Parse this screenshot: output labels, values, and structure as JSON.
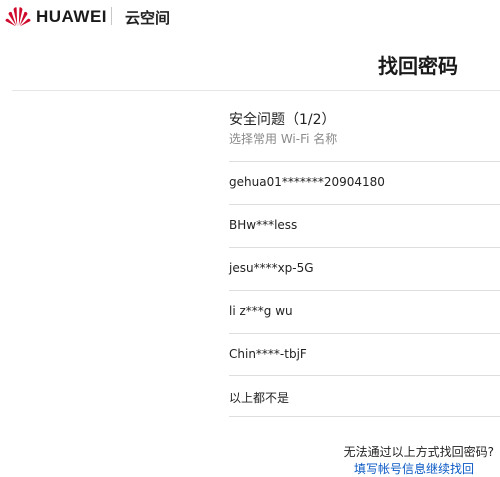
{
  "header": {
    "brand": "HUAWEI",
    "product": "云空间",
    "logo_icon": "huawei-flower-logo",
    "logo_color": "#cf0a2c"
  },
  "page": {
    "title": "找回密码"
  },
  "question": {
    "title": "安全问题（1/2）",
    "hint": "选择常用 Wi-Fi 名称"
  },
  "options": [
    {
      "label": "gehua01*******20904180"
    },
    {
      "label": "BHw***less"
    },
    {
      "label": "jesu****xp-5G"
    },
    {
      "label": "li z***g wu"
    },
    {
      "label": "Chin****-tbjF"
    },
    {
      "label": "以上都不是"
    }
  ],
  "footer": {
    "cannot_text": "无法通过以上方式找回密码?",
    "link_text": "填写帐号信息继续找回",
    "link_color": "#0a59c4"
  }
}
